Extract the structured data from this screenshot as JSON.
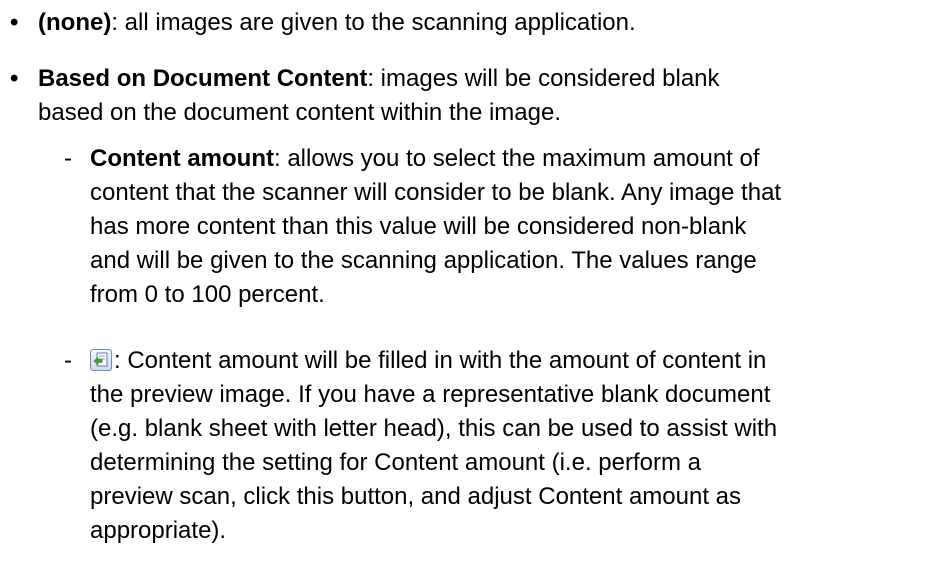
{
  "bullets": [
    {
      "marker": "•",
      "term": "(none)",
      "text": ": all images are given to the scanning application."
    },
    {
      "marker": "•",
      "term": "Based on Document Content",
      "text_line1": ": images will be considered blank",
      "text_line2": "based on the document content within the image."
    }
  ],
  "sub_items": [
    {
      "marker": "-",
      "term": "Content amount",
      "lines": [
        ": allows you to select the maximum amount of",
        "content that the scanner will consider to be blank. Any image that",
        "has more content than this value will be considered non-blank",
        "and will be given to the scanning application. The values range",
        "from 0 to 100 percent."
      ]
    },
    {
      "marker": "-",
      "icon": "fill-from-preview-icon",
      "lines": [
        ": Content amount will be filled in with the amount of content in",
        "the preview image. If you have a representative blank document",
        "(e.g. blank sheet with letter head), this can be used to assist with",
        "determining the setting for Content amount (i.e. perform a",
        "preview scan, click this button, and adjust Content amount as",
        "appropriate)."
      ]
    }
  ]
}
